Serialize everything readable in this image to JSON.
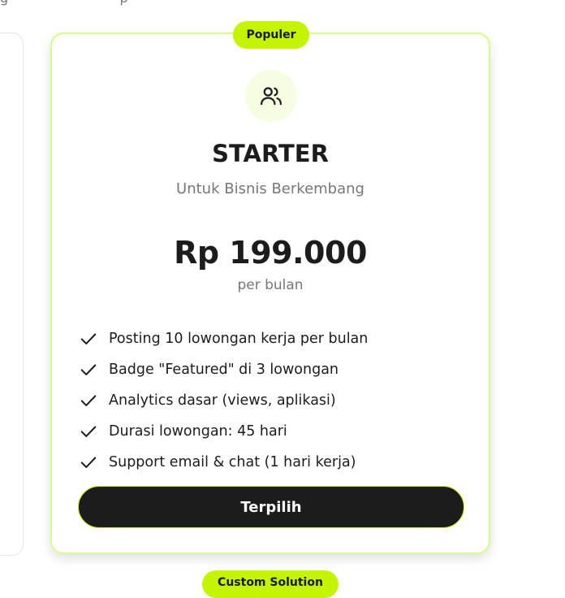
{
  "colors": {
    "accent": "#c4f400",
    "accent_border": "#d8fc8a",
    "dark": "#1c1c1c",
    "muted": "#777777"
  },
  "card": {
    "badge": "Populer",
    "icon": "users-icon",
    "title": "STARTER",
    "subtitle": "Untuk Bisnis Berkembang",
    "price": "Rp 199.000",
    "period": "per bulan",
    "features": [
      "Posting 10 lowongan kerja per bulan",
      "Badge \"Featured\" di 3 lowongan",
      "Analytics dasar (views, aplikasi)",
      "Durasi lowongan: 45 hari",
      "Support email & chat (1 hari kerja)"
    ],
    "button_label": "Terpilih"
  },
  "next_card": {
    "badge": "Custom Solution"
  }
}
